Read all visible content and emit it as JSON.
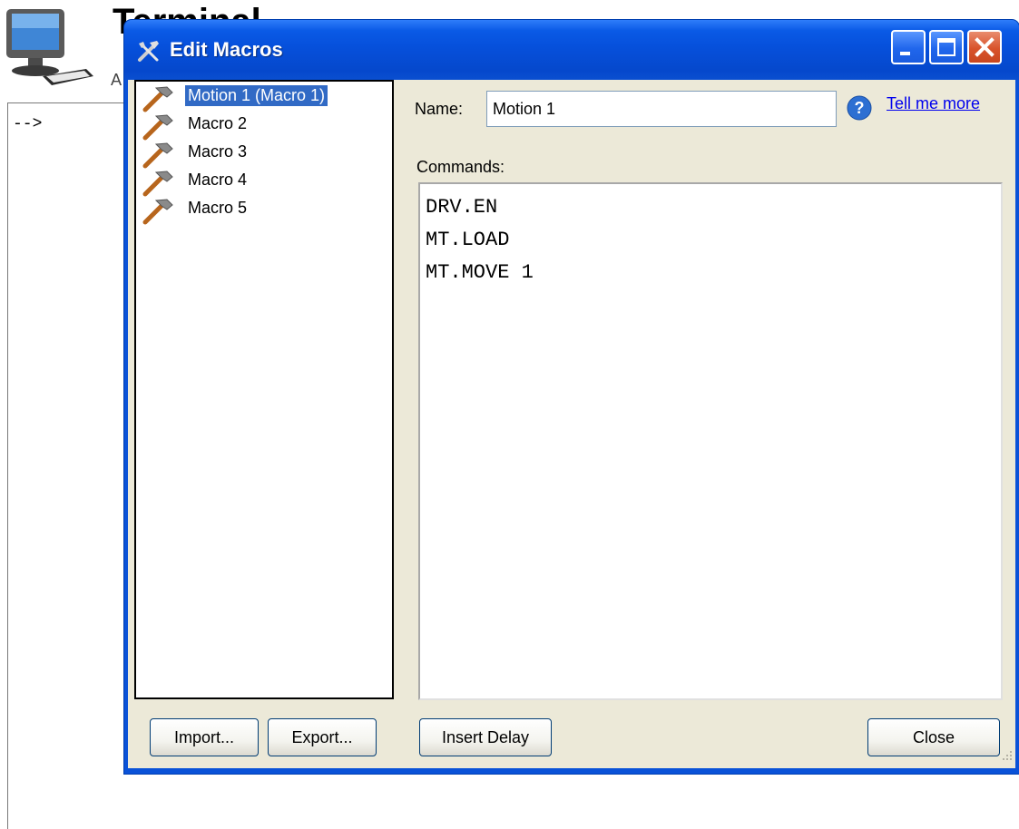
{
  "background_app": {
    "title": "Terminal",
    "subtitle": "A",
    "prompt": "-->"
  },
  "dialog": {
    "title": "Edit Macros",
    "icons": {
      "title": "tools-icon",
      "minimize": "minimize-icon",
      "maximize": "maximize-icon",
      "close": "close-icon",
      "macro": "hammer-icon",
      "help": "help-icon"
    },
    "macros": [
      {
        "label": "Motion 1 (Macro 1)",
        "selected": true
      },
      {
        "label": "Macro 2",
        "selected": false
      },
      {
        "label": "Macro 3",
        "selected": false
      },
      {
        "label": "Macro 4",
        "selected": false
      },
      {
        "label": "Macro 5",
        "selected": false
      }
    ],
    "name_label": "Name:",
    "name_value": "Motion 1",
    "help_link": "Tell me more",
    "commands_label": "Commands:",
    "commands": [
      "DRV.EN",
      "MT.LOAD",
      "MT.MOVE 1"
    ],
    "buttons": {
      "import": "Import...",
      "export": "Export...",
      "insert_delay": "Insert Delay",
      "close": "Close"
    }
  }
}
